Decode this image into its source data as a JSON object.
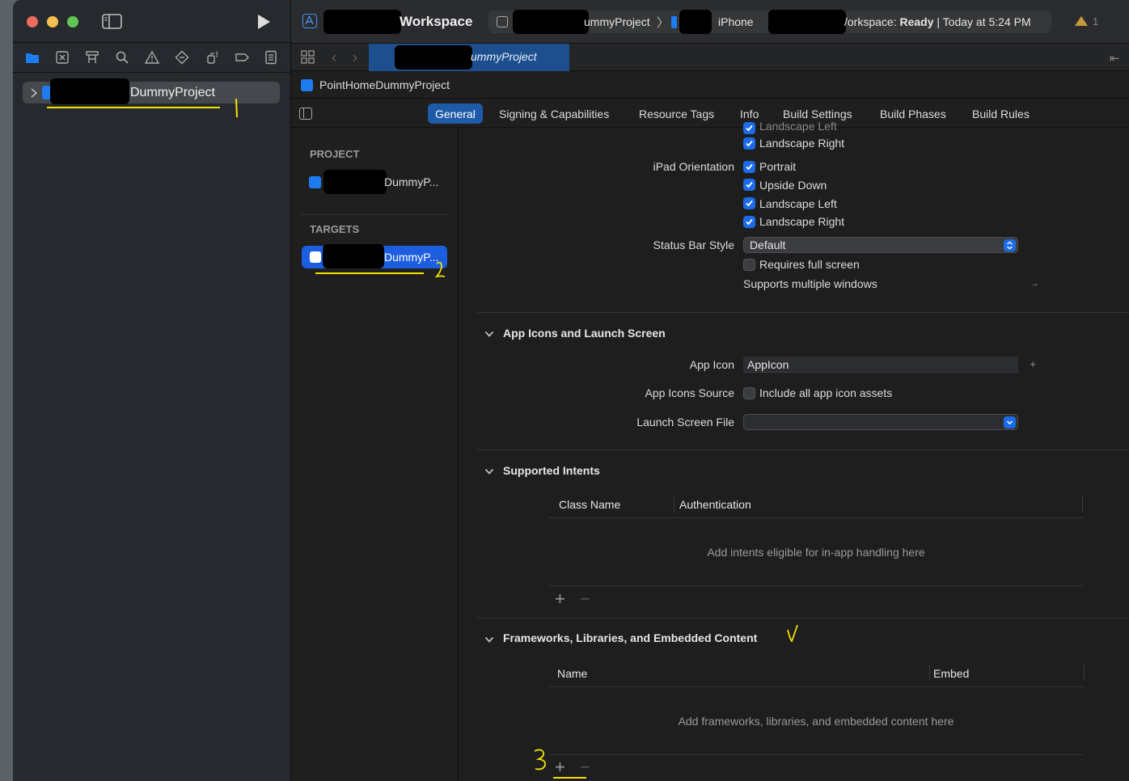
{
  "toolbar": {
    "workspace_label": "Workspace",
    "scheme_label": "ummyProject",
    "destination_label": "iPhone",
    "status_prefix": "/orkspace: ",
    "status_bold": "Ready",
    "status_suffix": " | Today at 5:24 PM",
    "warning_count": "1"
  },
  "navigator": {
    "project_name": "DummyProject"
  },
  "tabbar": {
    "active_tab_label": "ummyProject"
  },
  "jumpbar": {
    "project_label": "PointHomeDummyProject"
  },
  "segments": [
    "General",
    "Signing & Capabilities",
    "Resource Tags",
    "Info",
    "Build Settings",
    "Build Phases",
    "Build Rules"
  ],
  "targets_panel": {
    "project_header": "PROJECT",
    "project_item": "DummyP...",
    "targets_header": "TARGETS",
    "target_item": "DummyP..."
  },
  "deployment": {
    "cut_top_label": "Landscape Left",
    "iphone_landscape_right": "Landscape Right",
    "ipad_orientation_label": "iPad Orientation",
    "ipad_options": [
      "Portrait",
      "Upside Down",
      "Landscape Left",
      "Landscape Right"
    ],
    "status_bar_style_label": "Status Bar Style",
    "status_bar_style_value": "Default",
    "requires_full_screen": "Requires full screen",
    "supports_multiple_windows": "Supports multiple windows"
  },
  "app_icons": {
    "header": "App Icons and Launch Screen",
    "app_icon_label": "App Icon",
    "app_icon_value": "AppIcon",
    "app_icons_source_label": "App Icons Source",
    "include_all_label": "Include all app icon assets",
    "launch_screen_label": "Launch Screen File",
    "launch_screen_value": ""
  },
  "intents": {
    "header": "Supported Intents",
    "col_class": "Class Name",
    "col_auth": "Authentication",
    "empty": "Add intents eligible for in-app handling here"
  },
  "frameworks": {
    "header": "Frameworks, Libraries, and Embedded Content",
    "col_name": "Name",
    "col_embed": "Embed",
    "empty": "Add frameworks, libraries, and embedded content here"
  },
  "annotations": {
    "mark_1": "1",
    "mark_2": "2",
    "mark_3": "3"
  },
  "colors": {
    "accent": "#1c6ce8",
    "annotation": "#f2e200"
  }
}
